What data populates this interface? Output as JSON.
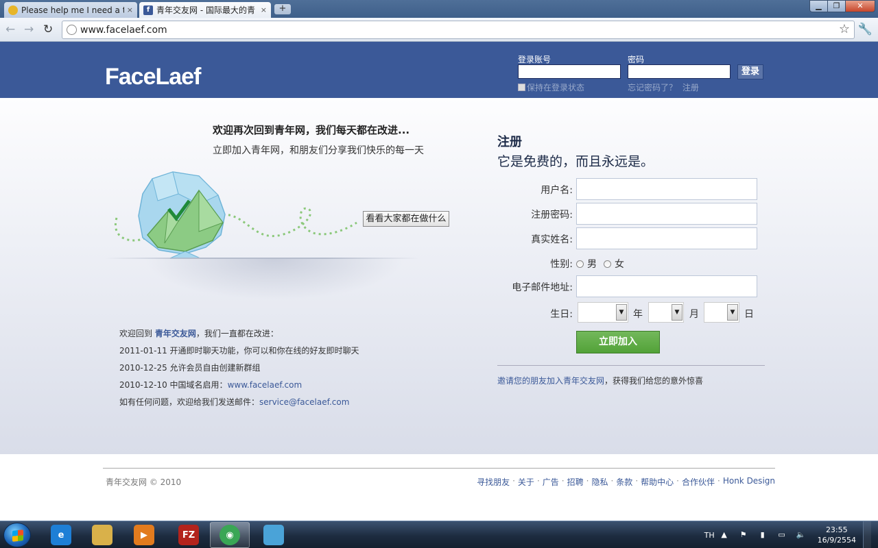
{
  "browser": {
    "tabs": [
      {
        "title": "Please help me I need a tem",
        "active": false
      },
      {
        "title": "青年交友网 - 国际最大的青",
        "active": true
      }
    ],
    "url": "www.facelaef.com",
    "close_glyph": "×",
    "newtab_glyph": "+"
  },
  "header": {
    "logo": "FaceLaef",
    "login": {
      "account_label": "登录账号",
      "password_label": "密码",
      "submit_label": "登录",
      "keep_label": "保持在登录状态",
      "forgot_label": "忘记密码了？",
      "register_label": "注册"
    }
  },
  "left": {
    "welcome_title": "欢迎再次回到青年网，我们每天都在改进...",
    "welcome_sub": "立即加入青年网，和朋友们分享我们快乐的每一天",
    "see_button": "看看大家都在做什么",
    "news": {
      "intro_prefix": "欢迎回到 ",
      "intro_brand": "青年交友网",
      "intro_suffix": "，我们一直都在改进：",
      "items": [
        "2011-01-11 开通即时聊天功能，你可以和你在线的好友即时聊天",
        "2010-12-25 允许会员自由创建新群组"
      ],
      "domain_prefix": "2010-12-10 中国域名启用：",
      "domain_link": "www.facelaef.com",
      "contact_prefix": "如有任何问题，欢迎给我们发送邮件：",
      "contact_email": "service@facelaef.com"
    }
  },
  "register": {
    "title": "注册",
    "subtitle": "它是免费的，而且永远是。",
    "username_label": "用户名:",
    "password_label": "注册密码:",
    "realname_label": "真实姓名:",
    "gender_label": "性别:",
    "gender_male": "男",
    "gender_female": "女",
    "email_label": "电子邮件地址:",
    "birthday_label": "生日:",
    "year_unit": "年",
    "month_unit": "月",
    "day_unit": "日",
    "submit": "立即加入",
    "invite_link": "邀请您的朋友加入青年交友网",
    "invite_suffix": "，获得我们给您的意外惊喜"
  },
  "footer": {
    "copyright": "青年交友网 © 2010",
    "links": [
      "寻找朋友",
      "关于",
      "广告",
      "招聘",
      "隐私",
      "条款",
      "帮助中心",
      "合作伙伴",
      "Honk Design"
    ],
    "separator": "·"
  },
  "taskbar": {
    "language": "TH",
    "time": "23:55",
    "date": "16/9/2554",
    "apps": [
      {
        "name": "internet-explorer",
        "color": "#1e7fd6",
        "glyph": "e"
      },
      {
        "name": "file-explorer",
        "color": "#d9b14a",
        "glyph": ""
      },
      {
        "name": "media-player",
        "color": "#e27b1e",
        "glyph": "▶"
      },
      {
        "name": "filezilla",
        "color": "#b3231c",
        "glyph": "FZ"
      },
      {
        "name": "chrome",
        "color": "#3aa655",
        "glyph": "◉"
      },
      {
        "name": "messenger",
        "color": "#4aa3d8",
        "glyph": ""
      }
    ]
  },
  "colors": {
    "brand": "#3b5998",
    "signup_green": "#5aa83f"
  }
}
